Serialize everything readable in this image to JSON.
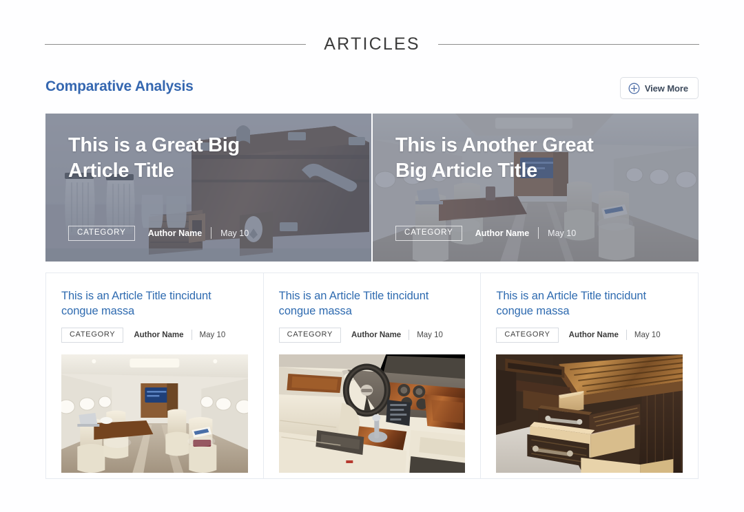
{
  "section": {
    "title": "ARTICLES",
    "subtitle": "Comparative Analysis",
    "view_more_label": "View More",
    "view_more_icon": "circle-plus-icon",
    "accent_color": "#3567b0",
    "title_color": "#3b3b3b",
    "rule_color": "#8b8b8b"
  },
  "heroes": [
    {
      "title": "This is a Great Big Article Title",
      "category": "CATEGORY",
      "author": "Author Name",
      "date": "May 10",
      "image_alt": "wooden-trunk-with-glassware",
      "overlay_color": "#687083"
    },
    {
      "title": "This is Another Great Big Article Title",
      "category": "CATEGORY",
      "author": "Author Name",
      "date": "May 10",
      "image_alt": "private-jet-cabin-interior",
      "overlay_color": "#687083"
    }
  ],
  "cards": [
    {
      "title": "This is an Article Title tincidunt congue massa",
      "category": "CATEGORY",
      "author": "Author Name",
      "date": "May 10",
      "image_alt": "private-jet-cabin-interior",
      "title_color": "#2f6bb0"
    },
    {
      "title": "This is an Article Title tincidunt congue massa",
      "category": "CATEGORY",
      "author": "Author Name",
      "date": "May 10",
      "image_alt": "luxury-car-interior-dashboard",
      "title_color": "#2f6bb0"
    },
    {
      "title": "This is an Article Title tincidunt congue massa",
      "category": "CATEGORY",
      "author": "Author Name",
      "date": "May 10",
      "image_alt": "wooden-cabinet-open-drawers",
      "title_color": "#2f6bb0"
    }
  ]
}
